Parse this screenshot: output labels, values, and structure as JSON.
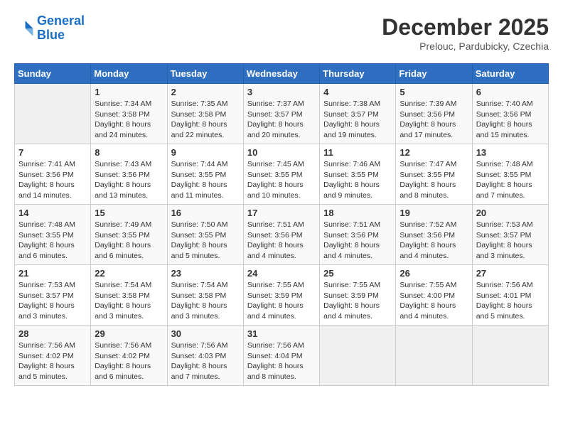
{
  "logo": {
    "line1": "General",
    "line2": "Blue"
  },
  "title": "December 2025",
  "subtitle": "Prelouc, Pardubicky, Czechia",
  "days_of_week": [
    "Sunday",
    "Monday",
    "Tuesday",
    "Wednesday",
    "Thursday",
    "Friday",
    "Saturday"
  ],
  "weeks": [
    [
      {
        "day": "",
        "info": ""
      },
      {
        "day": "1",
        "info": "Sunrise: 7:34 AM\nSunset: 3:58 PM\nDaylight: 8 hours\nand 24 minutes."
      },
      {
        "day": "2",
        "info": "Sunrise: 7:35 AM\nSunset: 3:58 PM\nDaylight: 8 hours\nand 22 minutes."
      },
      {
        "day": "3",
        "info": "Sunrise: 7:37 AM\nSunset: 3:57 PM\nDaylight: 8 hours\nand 20 minutes."
      },
      {
        "day": "4",
        "info": "Sunrise: 7:38 AM\nSunset: 3:57 PM\nDaylight: 8 hours\nand 19 minutes."
      },
      {
        "day": "5",
        "info": "Sunrise: 7:39 AM\nSunset: 3:56 PM\nDaylight: 8 hours\nand 17 minutes."
      },
      {
        "day": "6",
        "info": "Sunrise: 7:40 AM\nSunset: 3:56 PM\nDaylight: 8 hours\nand 15 minutes."
      }
    ],
    [
      {
        "day": "7",
        "info": "Sunrise: 7:41 AM\nSunset: 3:56 PM\nDaylight: 8 hours\nand 14 minutes."
      },
      {
        "day": "8",
        "info": "Sunrise: 7:43 AM\nSunset: 3:56 PM\nDaylight: 8 hours\nand 13 minutes."
      },
      {
        "day": "9",
        "info": "Sunrise: 7:44 AM\nSunset: 3:55 PM\nDaylight: 8 hours\nand 11 minutes."
      },
      {
        "day": "10",
        "info": "Sunrise: 7:45 AM\nSunset: 3:55 PM\nDaylight: 8 hours\nand 10 minutes."
      },
      {
        "day": "11",
        "info": "Sunrise: 7:46 AM\nSunset: 3:55 PM\nDaylight: 8 hours\nand 9 minutes."
      },
      {
        "day": "12",
        "info": "Sunrise: 7:47 AM\nSunset: 3:55 PM\nDaylight: 8 hours\nand 8 minutes."
      },
      {
        "day": "13",
        "info": "Sunrise: 7:48 AM\nSunset: 3:55 PM\nDaylight: 8 hours\nand 7 minutes."
      }
    ],
    [
      {
        "day": "14",
        "info": "Sunrise: 7:48 AM\nSunset: 3:55 PM\nDaylight: 8 hours\nand 6 minutes."
      },
      {
        "day": "15",
        "info": "Sunrise: 7:49 AM\nSunset: 3:55 PM\nDaylight: 8 hours\nand 6 minutes."
      },
      {
        "day": "16",
        "info": "Sunrise: 7:50 AM\nSunset: 3:55 PM\nDaylight: 8 hours\nand 5 minutes."
      },
      {
        "day": "17",
        "info": "Sunrise: 7:51 AM\nSunset: 3:56 PM\nDaylight: 8 hours\nand 4 minutes."
      },
      {
        "day": "18",
        "info": "Sunrise: 7:51 AM\nSunset: 3:56 PM\nDaylight: 8 hours\nand 4 minutes."
      },
      {
        "day": "19",
        "info": "Sunrise: 7:52 AM\nSunset: 3:56 PM\nDaylight: 8 hours\nand 4 minutes."
      },
      {
        "day": "20",
        "info": "Sunrise: 7:53 AM\nSunset: 3:57 PM\nDaylight: 8 hours\nand 3 minutes."
      }
    ],
    [
      {
        "day": "21",
        "info": "Sunrise: 7:53 AM\nSunset: 3:57 PM\nDaylight: 8 hours\nand 3 minutes."
      },
      {
        "day": "22",
        "info": "Sunrise: 7:54 AM\nSunset: 3:58 PM\nDaylight: 8 hours\nand 3 minutes."
      },
      {
        "day": "23",
        "info": "Sunrise: 7:54 AM\nSunset: 3:58 PM\nDaylight: 8 hours\nand 3 minutes."
      },
      {
        "day": "24",
        "info": "Sunrise: 7:55 AM\nSunset: 3:59 PM\nDaylight: 8 hours\nand 4 minutes."
      },
      {
        "day": "25",
        "info": "Sunrise: 7:55 AM\nSunset: 3:59 PM\nDaylight: 8 hours\nand 4 minutes."
      },
      {
        "day": "26",
        "info": "Sunrise: 7:55 AM\nSunset: 4:00 PM\nDaylight: 8 hours\nand 4 minutes."
      },
      {
        "day": "27",
        "info": "Sunrise: 7:56 AM\nSunset: 4:01 PM\nDaylight: 8 hours\nand 5 minutes."
      }
    ],
    [
      {
        "day": "28",
        "info": "Sunrise: 7:56 AM\nSunset: 4:02 PM\nDaylight: 8 hours\nand 5 minutes."
      },
      {
        "day": "29",
        "info": "Sunrise: 7:56 AM\nSunset: 4:02 PM\nDaylight: 8 hours\nand 6 minutes."
      },
      {
        "day": "30",
        "info": "Sunrise: 7:56 AM\nSunset: 4:03 PM\nDaylight: 8 hours\nand 7 minutes."
      },
      {
        "day": "31",
        "info": "Sunrise: 7:56 AM\nSunset: 4:04 PM\nDaylight: 8 hours\nand 8 minutes."
      },
      {
        "day": "",
        "info": ""
      },
      {
        "day": "",
        "info": ""
      },
      {
        "day": "",
        "info": ""
      }
    ]
  ]
}
